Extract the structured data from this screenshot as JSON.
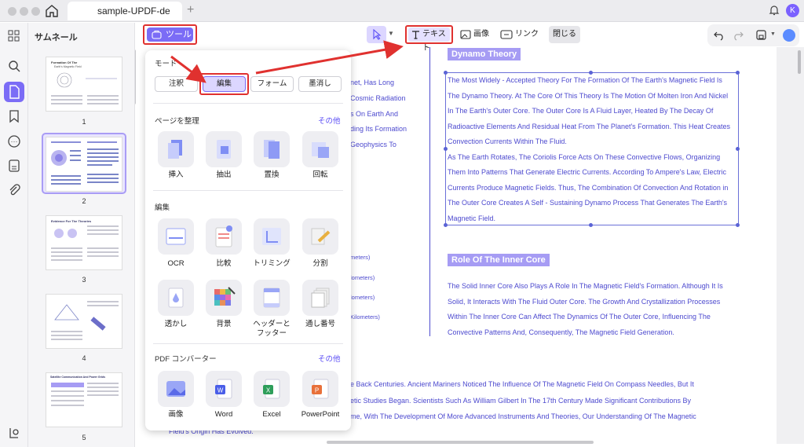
{
  "window": {
    "tab_title": "sample-UPDF-de",
    "avatar_letter": "K"
  },
  "thumbnails": {
    "title": "サムネール",
    "pages": [
      "1",
      "2",
      "3",
      "4",
      "5"
    ],
    "page1_title": "Formation Of The",
    "page1_subtitle": "Earth's Magnetic Field",
    "page3_title": "Evidence For The Theories",
    "page5_title": "Satellite Communication And Power Grids"
  },
  "toolbar": {
    "tools_label": "ツール",
    "text_label": "テキスト",
    "image_label": "画像",
    "link_label": "リンク",
    "close_label": "閉じる"
  },
  "popup": {
    "mode_title": "モード",
    "modes": [
      "注釈",
      "編集",
      "フォーム",
      "墨消し"
    ],
    "organize_title": "ページを整理",
    "organize_more": "その他",
    "organize_tools": [
      "挿入",
      "抽出",
      "置換",
      "回転"
    ],
    "edit_title": "編集",
    "edit_tools_row1": [
      "OCR",
      "比較",
      "トリミング",
      "分割"
    ],
    "edit_tools_row2": [
      "透かし",
      "背景",
      "ヘッダーと",
      "通し番号"
    ],
    "edit_tool_header_line2": "フッター",
    "converter_title": "PDF コンバーター",
    "converter_more": "その他",
    "converter_tools": [
      "画像",
      "Word",
      "Excel",
      "PowerPoint"
    ]
  },
  "document": {
    "left_fragments": [
      "net, Has Long",
      "Cosmic Radiation",
      "s On Earth And",
      "ding Its Formation",
      "Geophysics To"
    ],
    "left_units": [
      "meters)",
      "lometers)",
      "lometers)",
      "Kilometers)"
    ],
    "dynamo_heading": "Dynamo Theory",
    "dynamo_lines": [
      "The Most Widely - Accepted Theory For The Formation Of The Earth's Magnetic Field Is",
      "The Dynamo Theory. At The Core Of This Theory Is The Motion Of Molten Iron And Nickel",
      "In The Earth's Outer Core. The Outer Core Is A Fluid Layer, Heated By The Decay Of",
      "Radioactive Elements And Residual Heat From The Planet's Formation. This Heat Creates",
      "Convection Currents Within The Fluid.",
      "As The Earth Rotates, The Coriolis Force Acts On These Convective Flows, Organizing",
      "Them Into Patterns That Generate Electric Currents. According To Ampere's Law, Electric",
      "Currents Produce Magnetic Fields. Thus, The Combination Of Convection And Rotation in",
      "The Outer Core Creates A Self - Sustaining Dynamo Process That Generates The Earth's",
      "Magnetic Field."
    ],
    "inner_core_heading": "Role Of The Inner Core",
    "inner_core_lines": [
      "The Solid Inner Core Also Plays A Role In The Magnetic Field's Formation. Although It Is",
      "Solid, It Interacts With The Fluid Outer Core. The Growth And Crystallization Processes",
      "Within The Inner Core Can Affect The Dynamics Of The Outer Core, Influencing The",
      "Convective Patterns And, Consequently, The Magnetic Field Generation."
    ],
    "bottom_lines": [
      "e Back Centuries. Ancient Mariners Noticed The Influence Of The Magnetic Field On Compass Needles, But It",
      "etic Studies Began. Scientists Such As William Gilbert In The 17th Century Made Significant Contributions By",
      "me, With The Development Of More Advanced Instruments And Theories, Our Understanding Of The Magnetic"
    ],
    "bottom_last": "Field's Origin Has Evolved."
  },
  "colors": {
    "accent": "#7b6cf6",
    "highlight_red": "#e0312f",
    "doc_text": "#4d4acf",
    "heading_bg": "#a69cf4"
  }
}
